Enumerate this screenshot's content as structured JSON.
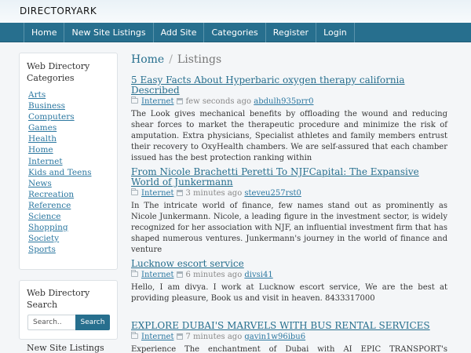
{
  "brand": "DIRECTORYARK",
  "nav": [
    "Home",
    "New Site Listings",
    "Add Site",
    "Categories",
    "Register",
    "Login"
  ],
  "sidebar": {
    "categories_title": "Web Directory Categories",
    "categories": [
      "Arts",
      "Business",
      "Computers",
      "Games",
      "Health",
      "Home",
      "Internet",
      "Kids and Teens",
      "News",
      "Recreation",
      "Reference",
      "Science",
      "Shopping",
      "Society",
      "Sports"
    ],
    "search_title": "Web Directory Search",
    "search_placeholder": "Search..",
    "search_button": "Search",
    "new_sites_title": "New Site Listings"
  },
  "breadcrumb": {
    "home": "Home",
    "sep": "/",
    "current": "Listings"
  },
  "listings": [
    {
      "title": "5 Easy Facts About Hyperbaric oxygen therapy california Described",
      "category": "Internet",
      "time": "few seconds ago",
      "user": "abdulh935prr0",
      "desc": "The Look gives mechanical benefits by offloading the wound and reducing shear forces to market the therapeutic procedure and minimize the risk of amputation. Extra physicians, Specialist athletes and family members entrust their recovery to OxyHealth chambers. We are self-assured that each chamber issued has the best protection ranking within"
    },
    {
      "title": "From Nicole Brachetti Peretti To NJFCapital: The Expansive World of Junkermann",
      "category": "Internet",
      "time": "3 minutes ago",
      "user": "steveu257rst0",
      "desc": "In The intricate world of finance, few names stand out as prominently as Nicole Junkermann. Nicole, a leading figure in the investment sector, is widely recognized for her association with NJF, an influential investment firm that has shaped numerous ventures. Junkermann's journey in the world of finance and venture"
    },
    {
      "title": "Lucknow escort service",
      "category": "Internet",
      "time": "6 minutes ago",
      "user": "divsi41",
      "desc": "Hello, I am divya. I work at Lucknow escort service, We are the best at providing pleasure, Book us and visit in heaven. 8433317000"
    },
    {
      "title": "EXPLORE DUBAI'S MARVELS WITH BUS RENTAL SERVICES",
      "category": "Internet",
      "time": "7 minutes ago",
      "user": "gavin1w96ibu6",
      "desc": "Experience The enchantment of Dubai with AI EPIC TRANSPORT's outstanding bus"
    }
  ]
}
